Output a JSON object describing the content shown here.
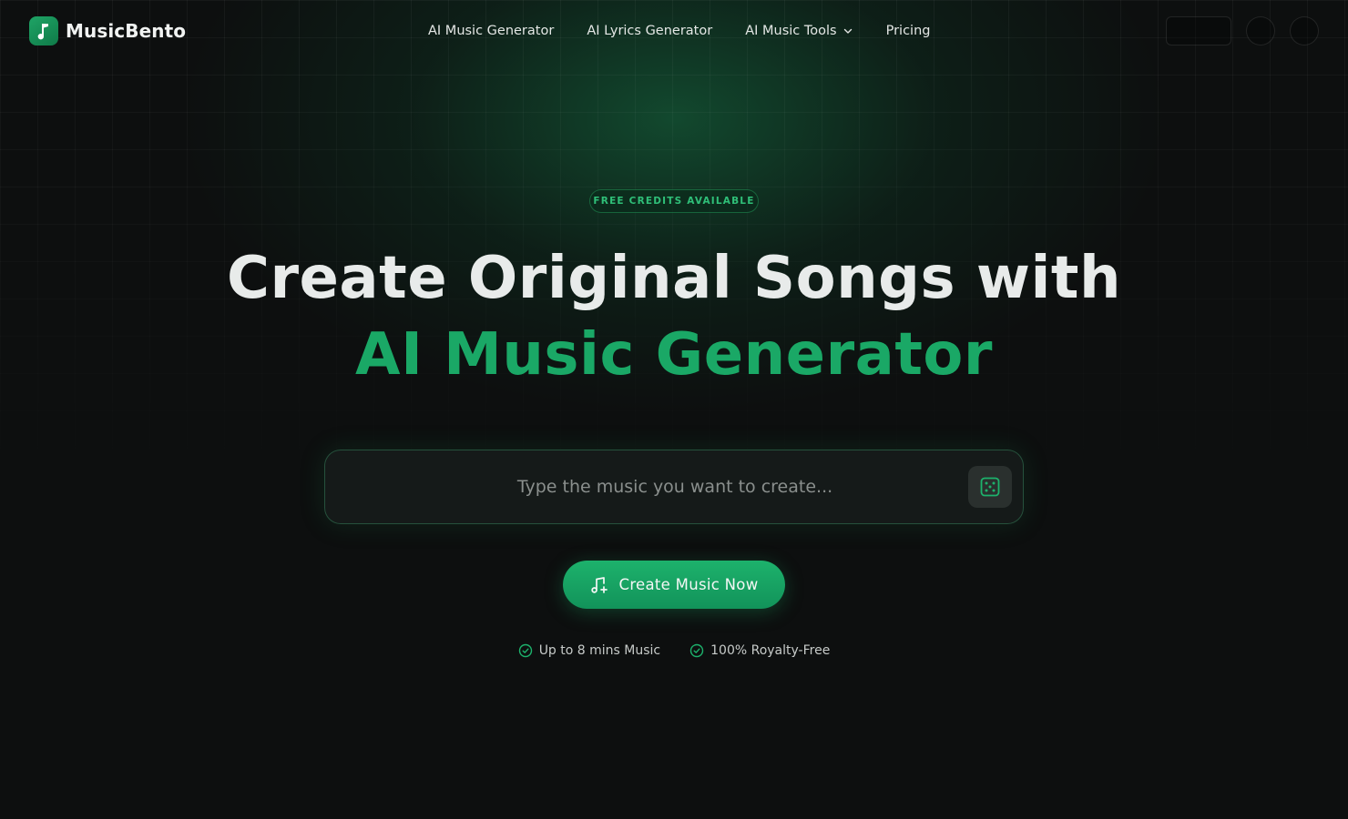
{
  "brand": {
    "name": "MusicBento",
    "logo_icon": "music-note-icon",
    "accent": "#1aa866"
  },
  "nav": {
    "items": [
      {
        "label": "AI Music Generator"
      },
      {
        "label": "AI Lyrics Generator"
      },
      {
        "label": "AI Music Tools",
        "icon": "chevron-down-icon"
      },
      {
        "label": "Pricing"
      }
    ]
  },
  "hero": {
    "badge": "FREE CREDITS AVAILABLE",
    "title_line1": "Create Original Songs with",
    "title_line2": "AI Music Generator",
    "prompt_placeholder": "Type the music you want to create...",
    "prompt_value": "",
    "random_icon": "dice-icon",
    "cta_label": "Create Music Now",
    "cta_icon": "music-plus-icon",
    "features": [
      {
        "label": "Up to 8 mins Music",
        "icon": "check-circle-icon"
      },
      {
        "label": "100% Royalty-Free",
        "icon": "check-circle-icon"
      }
    ]
  },
  "colors": {
    "background": "#0d0f0f",
    "accent": "#1aa866",
    "badge_text": "#2fbf78"
  }
}
